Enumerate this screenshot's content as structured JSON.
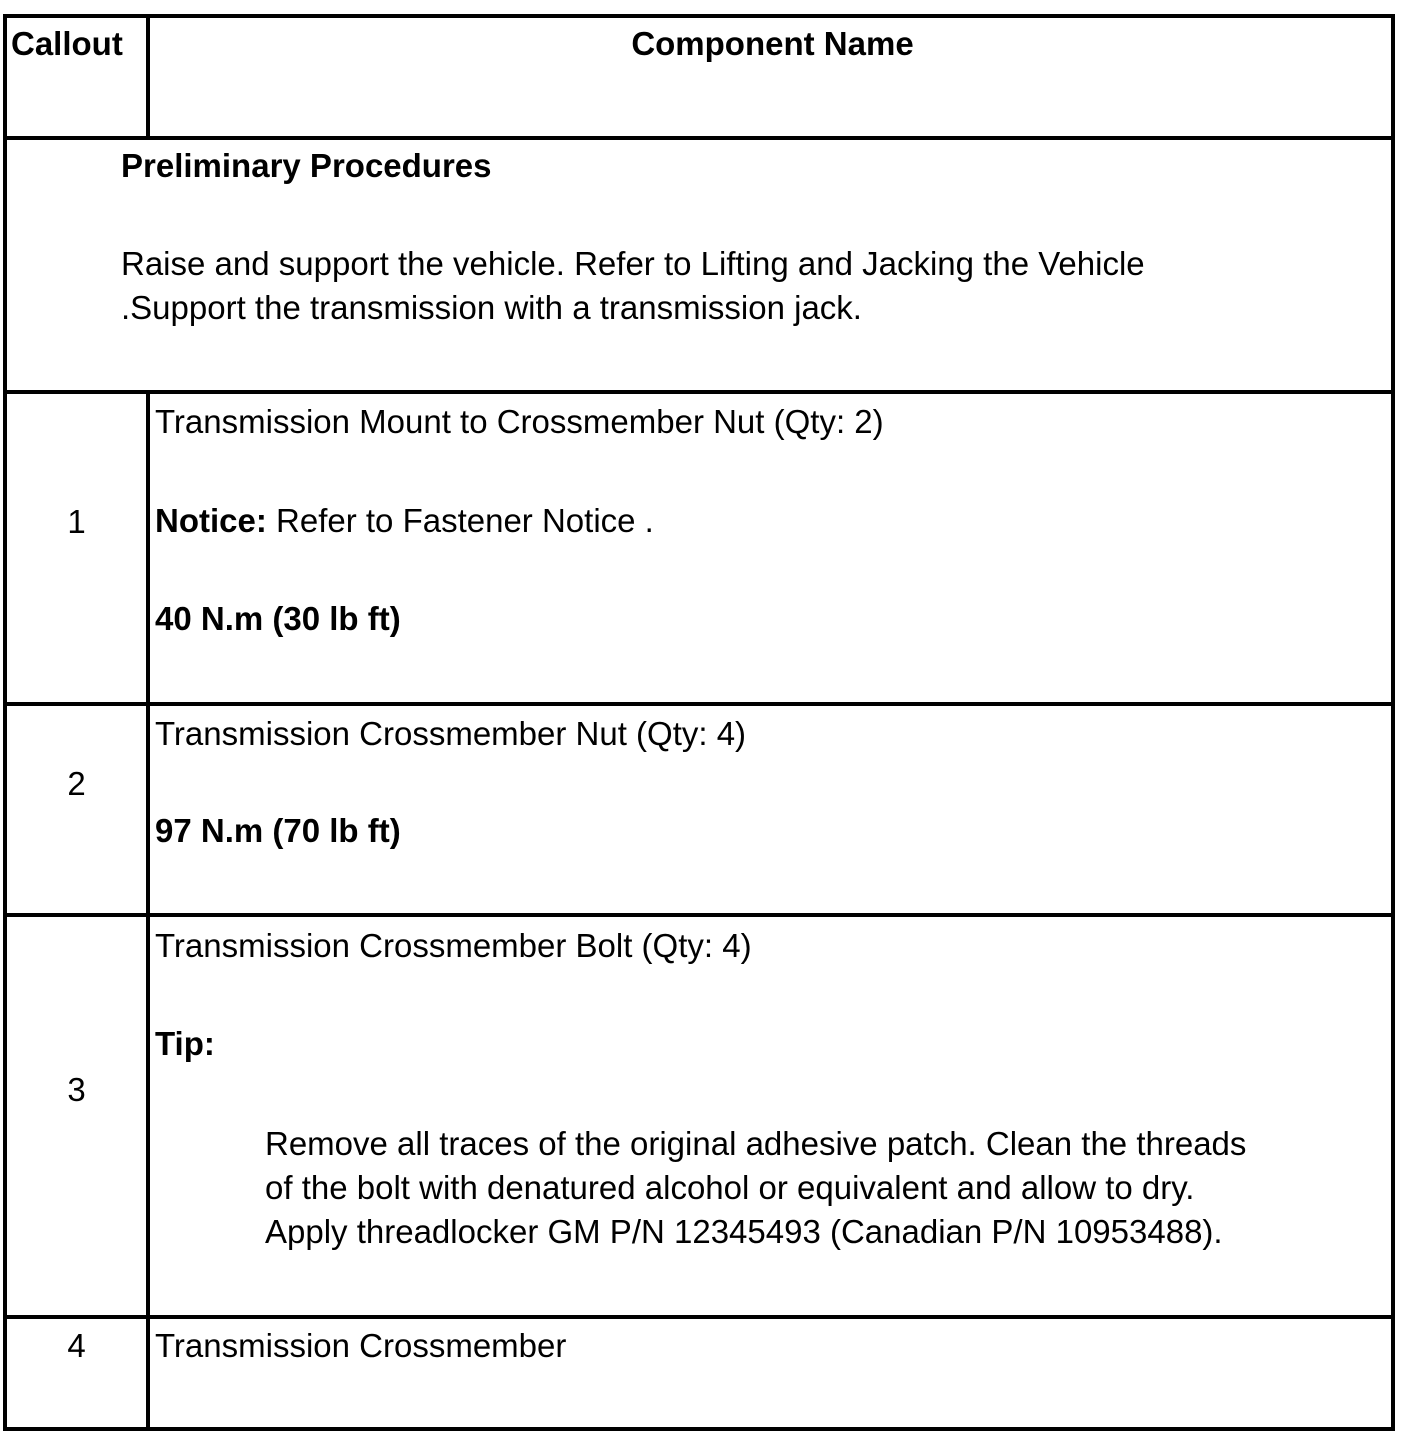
{
  "header": {
    "callout": "Callout",
    "component_name": "Component Name"
  },
  "preliminary": {
    "title": "Preliminary Procedures",
    "line1": "Raise and support the vehicle. Refer to Lifting and Jacking the Vehicle",
    "line2": ".Support the transmission with a transmission jack."
  },
  "rows": [
    {
      "callout": "1",
      "name": "Transmission Mount to Crossmember Nut (Qty: 2)",
      "notice_label": "Notice:",
      "notice_text": " Refer to Fastener Notice .",
      "torque": "40 N.m (30 lb ft)"
    },
    {
      "callout": "2",
      "name": "Transmission Crossmember Nut (Qty: 4)",
      "torque": "97 N.m (70 lb ft)"
    },
    {
      "callout": "3",
      "name": "Transmission Crossmember Bolt (Qty: 4)",
      "tip_label": "Tip:",
      "tip_line1": "Remove all traces of the original adhesive patch. Clean the threads",
      "tip_line2": "of the bolt with denatured alcohol or equivalent and allow to dry.",
      "tip_line3": "Apply threadlocker GM P/N 12345493 (Canadian P/N 10953488)."
    },
    {
      "callout": "4",
      "name": "Transmission Crossmember"
    }
  ]
}
